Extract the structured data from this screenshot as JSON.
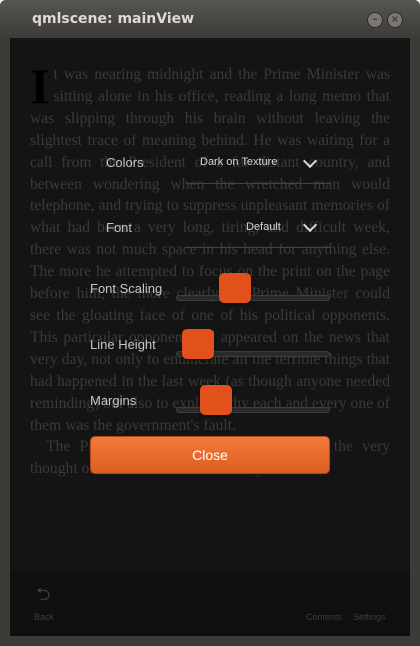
{
  "window": {
    "title": "qmlscene: mainView",
    "minimize_glyph": "–",
    "close_glyph": "×"
  },
  "book": {
    "dropcap": "I",
    "paragraph1": "t was nearing midnight and the Prime Minister was sitting alone in his office, reading a long memo that was slipping through his brain without leaving the slightest trace of meaning behind. He was waiting for a call from the President of a far distant country, and between wondering when the wretched man would telephone, and trying to suppress unpleasant memories of what had been a very long, tiring, and difficult week, there was not much space in his head for anything else. The more he attempted to focus on the print on the page before him, the more clearly the Prime Minister could see the gloating face of one of his political opponents. This particular opponent had appeared on the news that very day, not only to enumerate all the terrible things that had happened in the last week (as though anyone needed reminding) but also to explain why each and every one of them was the government's fault.",
    "paragraph2": "The Prime Minister's pulse quickened at the very thought of these accusations, for they were"
  },
  "settings": {
    "colors_label": "Colors",
    "colors_value": "Dark on Texture",
    "font_label": "Font",
    "font_value": "Default",
    "font_scaling_label": "Font Scaling",
    "font_scaling_level": 0.55,
    "line_height_label": "Line Height",
    "line_height_level": 0.12,
    "margins_label": "Margins",
    "margins_level": 0.22,
    "close_label": "Close"
  },
  "toolbar": {
    "back_label": "Back",
    "contents_label": "Contents",
    "settings_label": "Settings",
    "back_icon": "back-arrow-icon"
  },
  "colors": {
    "accent": "#e2501c",
    "button": "#e8692c"
  }
}
